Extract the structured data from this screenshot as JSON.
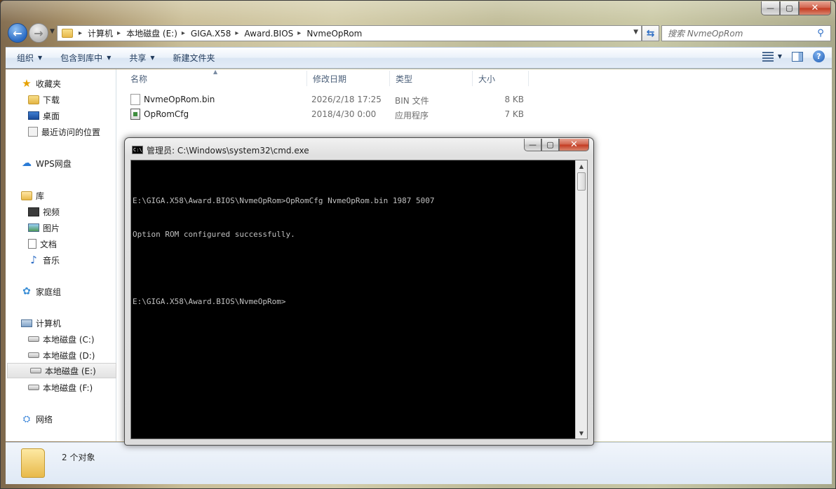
{
  "window": {
    "caption": {
      "minimize": "—",
      "maximize": "▢",
      "close": "✕"
    }
  },
  "address": {
    "crumbs": [
      "计算机",
      "本地磁盘 (E:)",
      "GIGA.X58",
      "Award.BIOS",
      "NvmeOpRom"
    ]
  },
  "search": {
    "placeholder": "搜索 NvmeOpRom"
  },
  "toolbar": {
    "organize": "组织",
    "include_library": "包含到库中",
    "share": "共享",
    "new_folder": "新建文件夹"
  },
  "nav_pane": {
    "favorites": "收藏夹",
    "downloads": "下载",
    "desktop": "桌面",
    "recent": "最近访问的位置",
    "wps": "WPS网盘",
    "libraries": "库",
    "videos": "视频",
    "pictures": "图片",
    "documents": "文档",
    "music": "音乐",
    "homegroup": "家庭组",
    "computer": "计算机",
    "drive_c": "本地磁盘 (C:)",
    "drive_d": "本地磁盘 (D:)",
    "drive_e": "本地磁盘 (E:)",
    "drive_f": "本地磁盘 (F:)",
    "network": "网络"
  },
  "file_list": {
    "columns": {
      "name": "名称",
      "date": "修改日期",
      "type": "类型",
      "size": "大小"
    },
    "files": [
      {
        "name": "NvmeOpRom.bin",
        "date": "2026/2/18 17:25",
        "type": "BIN 文件",
        "size": "8 KB"
      },
      {
        "name": "OpRomCfg",
        "date": "2018/4/30 0:00",
        "type": "应用程序",
        "size": "7 KB"
      }
    ]
  },
  "details": {
    "item_count": "2 个对象"
  },
  "cmd": {
    "icon_text": "C:\\",
    "title": "管理员: C:\\Windows\\system32\\cmd.exe",
    "lines": [
      "E:\\GIGA.X58\\Award.BIOS\\NvmeOpRom>OpRomCfg NvmeOpRom.bin 1987 5007",
      "Option ROM configured successfully.",
      "",
      "E:\\GIGA.X58\\Award.BIOS\\NvmeOpRom>"
    ]
  }
}
